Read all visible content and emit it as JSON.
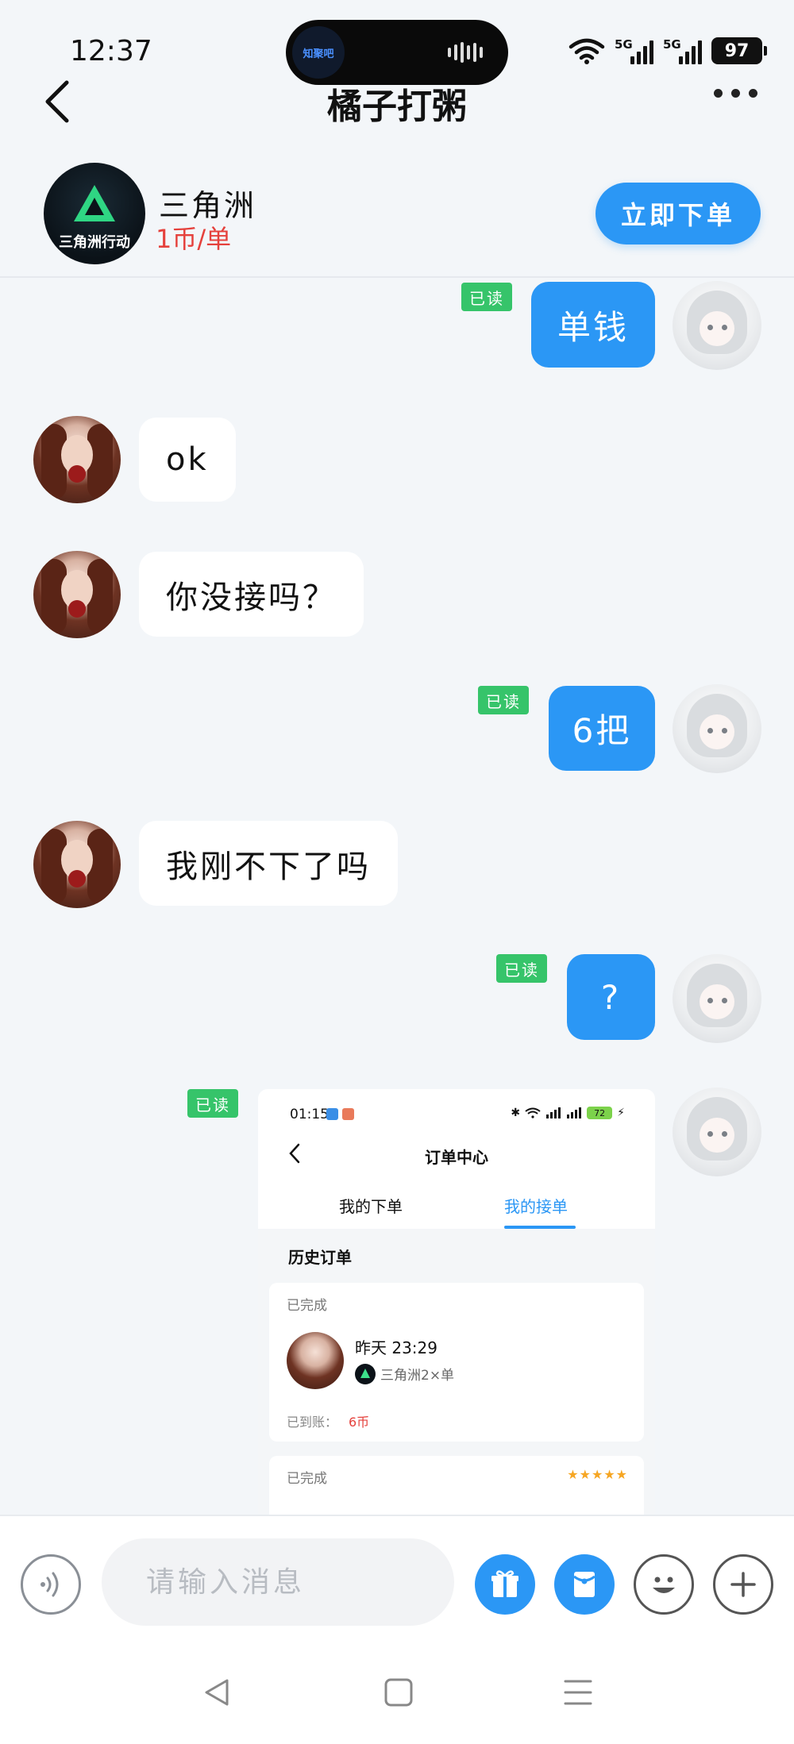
{
  "status_bar": {
    "time": "12:37",
    "island_app": "知聚吧",
    "signal_1": "5G",
    "signal_2": "5G",
    "battery": "97"
  },
  "nav": {
    "title": "橘子打粥"
  },
  "service": {
    "logo_text": "三角洲行动",
    "name": "三角洲",
    "price": "1币/单",
    "order_button": "立即下单"
  },
  "messages": [
    {
      "side": "out",
      "text": "单钱",
      "read": "已读"
    },
    {
      "side": "in",
      "text": "ok"
    },
    {
      "side": "in",
      "text": "你没接吗？"
    },
    {
      "side": "out",
      "text": "6把",
      "read": "已读"
    },
    {
      "side": "in",
      "text": "我刚不下了吗"
    },
    {
      "side": "out",
      "text": "?",
      "read": "已读"
    }
  ],
  "image_message": {
    "read": "已读",
    "time": "01:15",
    "battery": "72",
    "title": "订单中心",
    "tab_mine": "我的下单",
    "tab_taken": "我的接单",
    "history_label": "历史订单",
    "cards": [
      {
        "status": "已完成",
        "date": "昨天 23:29",
        "game": "三角洲2×单",
        "earn_label": "已到账：",
        "earn_value": "6币"
      },
      {
        "status": "已完成",
        "stars": "★★★★★"
      }
    ]
  },
  "input_bar": {
    "placeholder": "请输入消息"
  },
  "icons": {
    "voice": "voice-icon",
    "gift": "gift-icon",
    "red_packet": "red-packet-icon",
    "emoji": "emoji-icon",
    "plus": "plus-icon"
  },
  "colors": {
    "accent": "#2b97f5",
    "read_badge": "#36c46a",
    "price": "#e5413c"
  }
}
